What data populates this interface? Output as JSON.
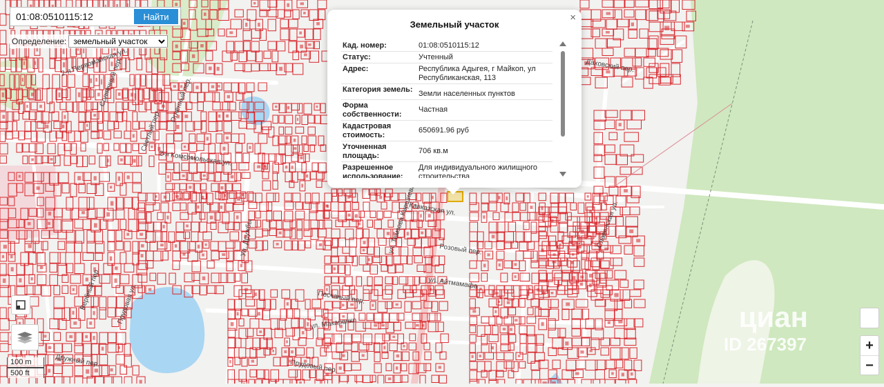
{
  "search": {
    "value": "01:08:0510115:12",
    "button_label": "Найти"
  },
  "mode": {
    "label": "Определение:",
    "selected": "земельный участок"
  },
  "popup": {
    "title": "Земельный участок",
    "close": "×",
    "rows": [
      {
        "key": "Кад. номер:",
        "value": "01:08:0510115:12"
      },
      {
        "key": "Статус:",
        "value": "Учтенный"
      },
      {
        "key": "Адрес:",
        "value": "Республика Адыгея, г Майкоп, ул Республиканская, 113"
      },
      {
        "key": "Категория земель:",
        "value": "Земли населенных пунктов"
      },
      {
        "key": "Форма собственности:",
        "value": "Частная"
      },
      {
        "key": "Кадастровая стоимость:",
        "value": "650691.96 руб"
      },
      {
        "key": "Уточненная площадь:",
        "value": "706 кв.м"
      },
      {
        "key": "Разрешенное использование:",
        "value": "Для индивидуального жилищного строительства"
      }
    ]
  },
  "zoom": {
    "in": "+",
    "out": "−"
  },
  "scale": {
    "metric": "100 m",
    "imperial": "500 ft"
  },
  "watermark": {
    "brand": "циан",
    "code": "ID 267397"
  },
  "street_labels": [
    "2-я Первомайская ул.",
    "2-я Комсомольская ул.",
    "Кавказская ул.",
    "Розовый пер.",
    "ул. Айтмамафа",
    "Песчаный пер.",
    "ул. Макаренко",
    "Ул. Дружбы",
    "ул. Темзова Киршиева",
    "Даховский пер.",
    "Славянская ул.",
    "Светлый пер.",
    "Огненный пер.",
    "Солнечный пер.",
    "Вербный пер.",
    "Прудовая ул.",
    "Прудовый пер.",
    "Дружный пер."
  ],
  "colors": {
    "plot_outline": "#d8262c",
    "water": "#a9d6f2",
    "green": "#cfe8bf",
    "popup_bg": "#ffffff",
    "search_button": "#2a8fd6"
  }
}
